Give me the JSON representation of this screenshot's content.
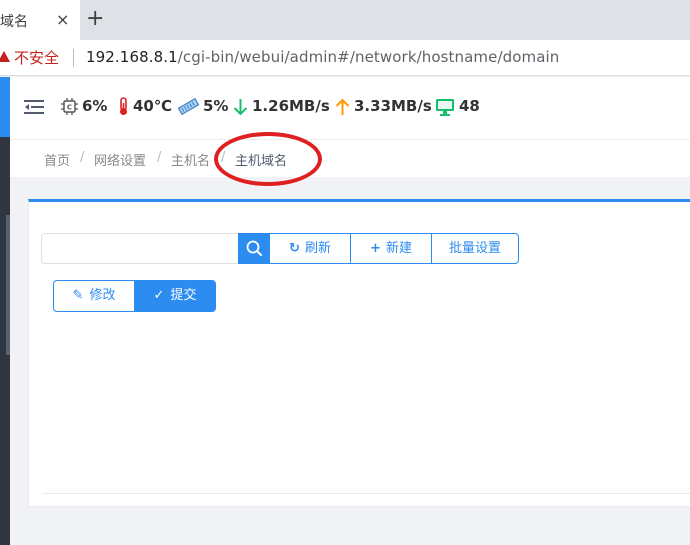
{
  "browser": {
    "tab_title": "域名",
    "tab_close": "×",
    "new_tab": "+",
    "security_label": "不安全",
    "url_host": "192.168.8.1",
    "url_path": "/cgi-bin/webui/admin#/network/hostname/domain"
  },
  "status": {
    "cpu": "6%",
    "temperature": "40℃",
    "memory": "5%",
    "download": "1.26MB/s",
    "upload": "3.33MB/s",
    "clients": "48"
  },
  "breadcrumb": {
    "items": [
      "首页",
      "网络设置",
      "主机名",
      "主机域名"
    ],
    "separator": "/"
  },
  "toolbar": {
    "search_placeholder": "",
    "refresh_label": "刷新",
    "new_label": "新建",
    "batch_label": "批量设置"
  },
  "actions": {
    "edit_label": "修改",
    "submit_label": "提交"
  },
  "colors": {
    "primary": "#2d8cf0",
    "insecure": "#c5221f",
    "annotation": "#e02020",
    "download": "#19be6b",
    "upload": "#ff9900"
  },
  "icons": {
    "cpu": "cpu-chip-icon",
    "temperature": "thermometer-icon",
    "memory": "memory-icon",
    "download": "arrow-down-icon",
    "upload": "arrow-up-icon",
    "clients": "monitor-icon"
  }
}
